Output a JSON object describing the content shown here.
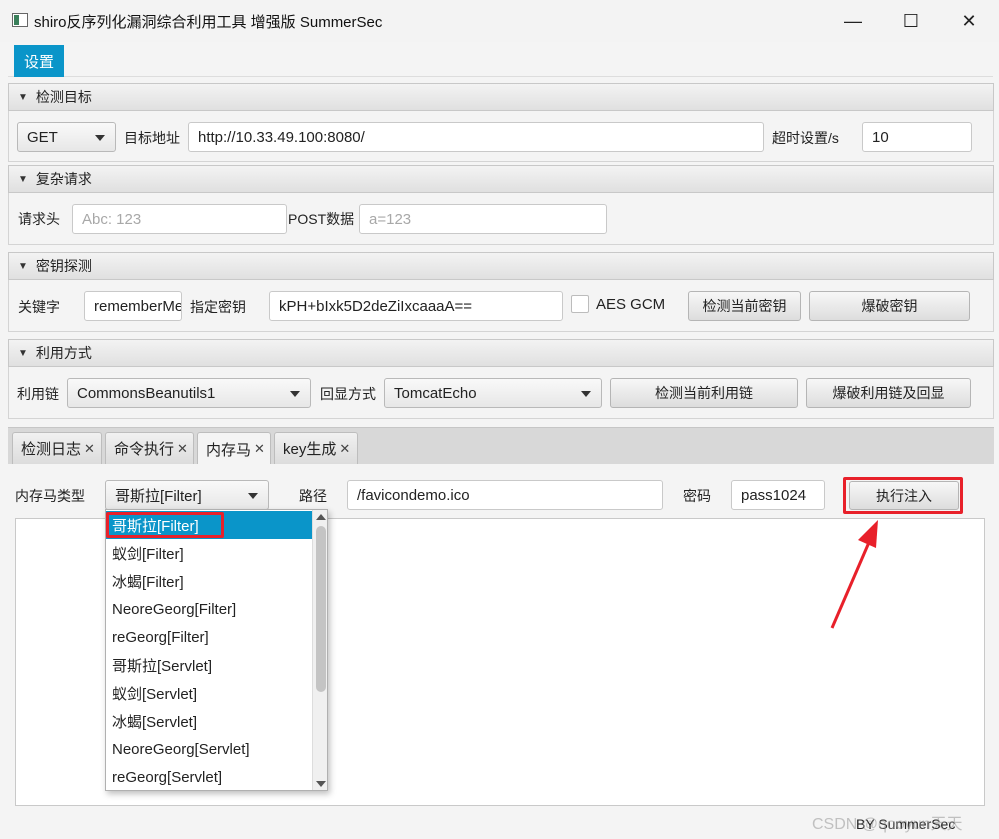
{
  "window": {
    "title": "shiro反序列化漏洞综合利用工具 增强版 SummerSec",
    "minimize": "—",
    "maximize": "☐",
    "close": "✕"
  },
  "menu": {
    "settings": "设置"
  },
  "detect_target": {
    "title": "检测目标",
    "method": "GET",
    "url_label": "目标地址",
    "url": "http://10.33.49.100:8080/",
    "timeout_label": "超时设置/s",
    "timeout": "10"
  },
  "complex_request": {
    "title": "复杂请求",
    "header_label": "请求头",
    "header_placeholder": "Abc: 123",
    "post_label": "POST数据",
    "post_placeholder": "a=123"
  },
  "key_detect": {
    "title": "密钥探测",
    "keyword_label": "关键字",
    "keyword": "rememberMe",
    "key_label": "指定密钥",
    "key": "kPH+bIxk5D2deZiIxcaaaA==",
    "aes_gcm_label": "AES GCM",
    "check_key_button": "检测当前密钥",
    "brute_key_button": "爆破密钥"
  },
  "exploit": {
    "title": "利用方式",
    "chain_label": "利用链",
    "chain": "CommonsBeanutils1",
    "echo_label": "回显方式",
    "echo": "TomcatEcho",
    "check_chain_button": "检测当前利用链",
    "brute_chain_button": "爆破利用链及回显"
  },
  "tabs": [
    {
      "label": "检测日志",
      "close": "✕"
    },
    {
      "label": "命令执行",
      "close": "✕"
    },
    {
      "label": "内存马",
      "close": "✕"
    },
    {
      "label": "key生成",
      "close": "✕"
    }
  ],
  "memshell": {
    "type_label": "内存马类型",
    "type": "哥斯拉[Filter]",
    "path_label": "路径",
    "path": "/favicondemo.ico",
    "password_label": "密码",
    "password": "pass1024",
    "inject_button": "执行注入",
    "options": [
      "哥斯拉[Filter]",
      "蚁剑[Filter]",
      "冰蝎[Filter]",
      "NeoreGeorg[Filter]",
      "reGeorg[Filter]",
      "哥斯拉[Servlet]",
      "蚁剑[Servlet]",
      "冰蝎[Servlet]",
      "NeoreGeorg[Servlet]",
      "reGeorg[Servlet]"
    ]
  },
  "footer": "BY SummerSec",
  "watermark": "CSDN @qooyun天天",
  "colors": {
    "accent": "#0a95c9",
    "annotation": "#e8202a"
  }
}
